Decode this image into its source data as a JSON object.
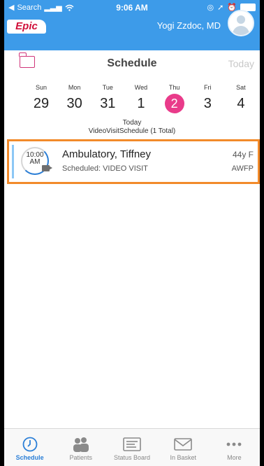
{
  "status_bar": {
    "carrier": "Search",
    "time": "9:06 AM"
  },
  "header": {
    "logo_text": "Epic",
    "user_name": "Yogi Zzdoc, MD"
  },
  "toolbar": {
    "title": "Schedule",
    "today_label": "Today"
  },
  "week": [
    {
      "dow": "Sun",
      "date": "29"
    },
    {
      "dow": "Mon",
      "date": "30"
    },
    {
      "dow": "Tue",
      "date": "31"
    },
    {
      "dow": "Wed",
      "date": "1"
    },
    {
      "dow": "Thu",
      "date": "2",
      "selected": true
    },
    {
      "dow": "Fri",
      "date": "3"
    },
    {
      "dow": "Sat",
      "date": "4"
    }
  ],
  "schedule": {
    "today_label": "Today",
    "name_label": "VideoVisitSchedule (1 Total)"
  },
  "appointment": {
    "time": "10:00",
    "ampm": "AM",
    "patient_name": "Ambulatory, Tiffney",
    "age_sex": "44y F",
    "status": "Scheduled: VIDEO VISIT",
    "department": "AWFP"
  },
  "tabs": [
    {
      "label": "Schedule",
      "icon": "clock-icon",
      "active": true
    },
    {
      "label": "Patients",
      "icon": "patients-icon"
    },
    {
      "label": "Status Board",
      "icon": "status-board-icon"
    },
    {
      "label": "In Basket",
      "icon": "envelope-icon"
    },
    {
      "label": "More",
      "icon": "more-icon"
    }
  ],
  "colors": {
    "header": "#3d9be9",
    "accent_pink": "#e93b8a",
    "highlight_orange": "#f28a2a",
    "tab_active": "#2b7fd7"
  }
}
